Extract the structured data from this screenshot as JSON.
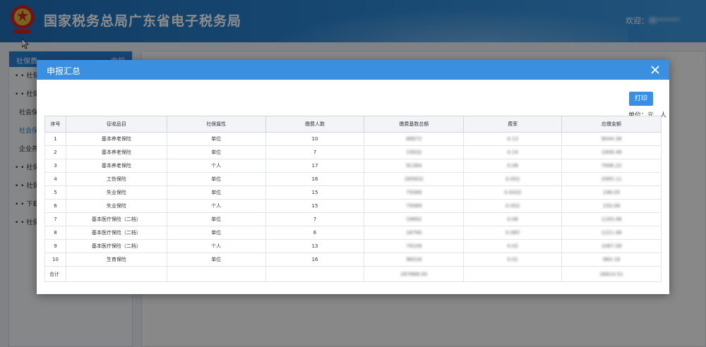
{
  "header": {
    "title": "国家税务总局广东省电子税务局",
    "welcome": "欢迎：",
    "user": "杨******"
  },
  "sidebar": {
    "head_label": "社保费",
    "head_right": "申报",
    "items": [
      {
        "label": "社保费",
        "sub": false,
        "active": false
      },
      {
        "label": "社保费",
        "sub": false,
        "active": false
      },
      {
        "label": "社会保",
        "sub": true,
        "active": false
      },
      {
        "label": "社会保",
        "sub": true,
        "active": true
      },
      {
        "label": "企业养",
        "sub": true,
        "active": false
      },
      {
        "label": "社保费",
        "sub": false,
        "active": false
      },
      {
        "label": "社保费",
        "sub": false,
        "active": false
      },
      {
        "label": "下载中",
        "sub": false,
        "active": false
      },
      {
        "label": "社保文",
        "sub": false,
        "active": false
      }
    ]
  },
  "modal": {
    "title": "申报汇总",
    "print_label": "打印",
    "unit_label": "单位：元，人",
    "columns": [
      "序号",
      "征收品目",
      "社保属性",
      "缴费人数",
      "缴费基数总额",
      "费率",
      "应缴金额"
    ],
    "rows": [
      [
        "1",
        "基本养老保险",
        "单位",
        "10",
        "68672",
        "0.13",
        "9044.36"
      ],
      [
        "2",
        "基本养老保险",
        "单位",
        "7",
        "15632",
        "0.14",
        "1908.48"
      ],
      [
        "3",
        "基本养老保险",
        "个人",
        "17",
        "91384",
        "0.08",
        "7996.22"
      ],
      [
        "4",
        "工伤保险",
        "单位",
        "16",
        "285832",
        "0.002",
        "2065.11"
      ],
      [
        "5",
        "失业保险",
        "单位",
        "15",
        "75089",
        "0.0032",
        "196.05"
      ],
      [
        "6",
        "失业保险",
        "个人",
        "15",
        "75089",
        "0.002",
        "150.08"
      ],
      [
        "7",
        "基本医疗保险（二档）",
        "单位",
        "7",
        "19892",
        "0.06",
        "1193.46"
      ],
      [
        "8",
        "基本医疗保险（二档）",
        "单位",
        "6",
        "18790",
        "0.065",
        "1221.46"
      ],
      [
        "9",
        "基本医疗保险（二档）",
        "个人",
        "13",
        "79108",
        "0.02",
        "1087.08"
      ],
      [
        "10",
        "生育保险",
        "单位",
        "16",
        "96016",
        "0.01",
        "960.16"
      ]
    ],
    "total": {
      "label": "合计",
      "base": "267868.00",
      "amount": "26814.51"
    }
  }
}
